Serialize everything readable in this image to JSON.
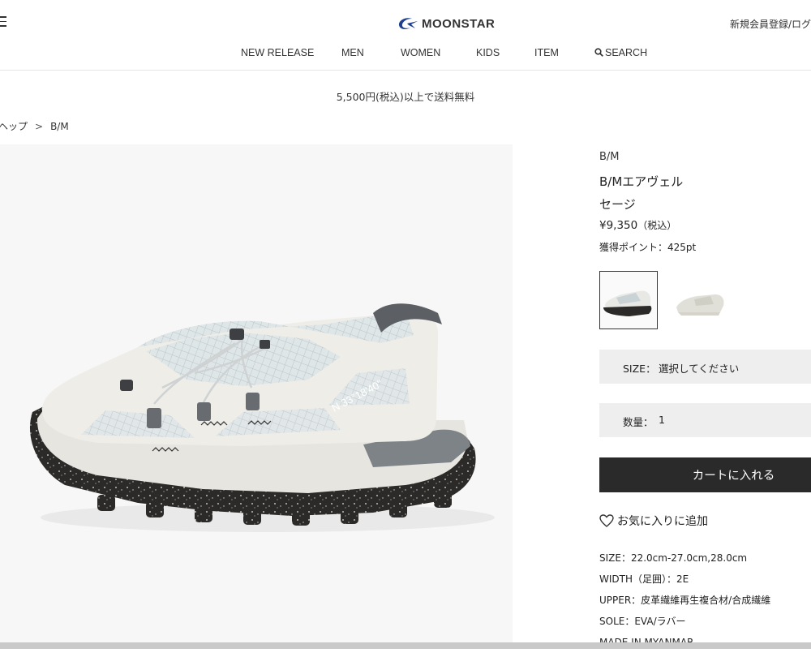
{
  "header": {
    "logo_text": "MOONSTAR",
    "account_link": "新規会員登録/ログ",
    "nav": [
      {
        "label": "NEW RELEASE"
      },
      {
        "label": "MEN"
      },
      {
        "label": "WOMEN"
      },
      {
        "label": "KIDS"
      },
      {
        "label": "ITEM"
      },
      {
        "label": "SEARCH",
        "icon": "search-icon"
      }
    ]
  },
  "banner": {
    "shipping_text": "5,500円(税込)以上で送料無料"
  },
  "breadcrumb": {
    "items": [
      "ヘップ",
      "B/M"
    ],
    "separator": ">"
  },
  "product": {
    "brand": "B/M",
    "name": "B/Mエアヴェル",
    "color": "セージ",
    "price": "¥9,350",
    "price_tax_note": "（税込）",
    "points": "獲得ポイント：425pt",
    "image_print": "N 33°18'40\"",
    "size_select": {
      "label": "SIZE：",
      "value": "選択してください"
    },
    "quantity": {
      "label": "数量：",
      "value": "1"
    },
    "add_to_cart": "カートに入れる",
    "favorite": "お気に入りに追加",
    "specs": [
      "SIZE：22.0cm-27.0cm,28.0cm",
      "WIDTH（足囲）：2E",
      "UPPER：皮革繊維再生複合材/合成繊維",
      "SOLE：EVA/ラバー",
      "MADE IN MYANMAR"
    ]
  },
  "colors": {
    "brand_blue": "#1d3f8f",
    "cart_button": "#2a2a2a",
    "select_bg": "#eeeeee"
  }
}
